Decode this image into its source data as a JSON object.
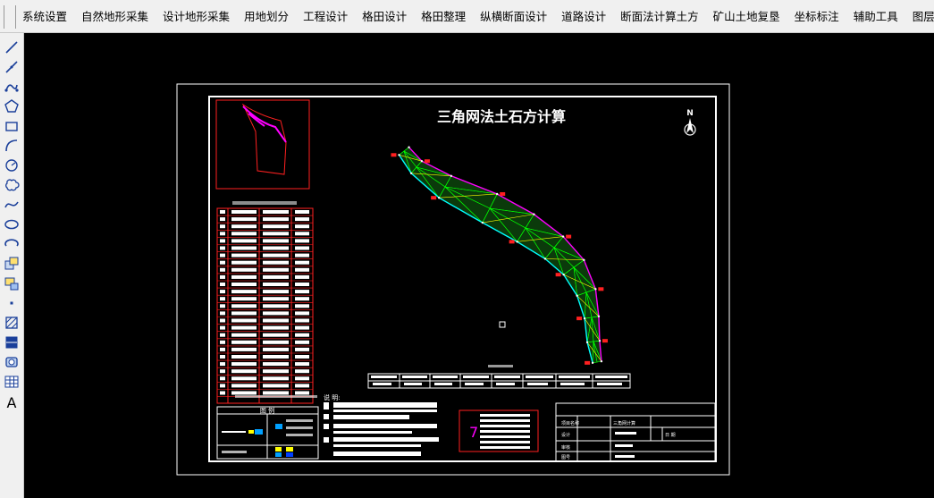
{
  "menu": {
    "items": [
      "系统设置",
      "自然地形采集",
      "设计地形采集",
      "用地划分",
      "工程设计",
      "格田设计",
      "格田整理",
      "纵横断面设计",
      "道路设计",
      "断面法计算土方",
      "矿山土地复垦",
      "坐标标注",
      "辅助工具",
      "图层图件"
    ]
  },
  "toolbar": {
    "tools": [
      "line-tool-icon",
      "polyline-tool-icon",
      "spline-connect-icon",
      "polygon-tool-icon",
      "rectangle-tool-icon",
      "arc-tool-icon",
      "circle-tool-icon",
      "cloud-tool-icon",
      "curve-tool-icon",
      "ellipse-tool-icon",
      "ellipse-arc-icon",
      "insert-block-icon",
      "make-block-icon",
      "point-tool-icon",
      "hatch-tool-icon",
      "gradient-tool-icon",
      "region-tool-icon",
      "table-tool-icon",
      "text-tool-icon"
    ],
    "text_tool_label": "A"
  },
  "drawing": {
    "title": "三角网法土石方计算",
    "north_label": "N",
    "legend_title": "图 例",
    "notes_label": "说 明:",
    "volume_number": "7",
    "title_block": {
      "rows": [
        "项目名称",
        "设计",
        "审核",
        "图号"
      ],
      "fields": [
        "日 期"
      ],
      "values": [
        "三角网计算"
      ]
    },
    "colors": {
      "frame": "#ffffff",
      "red": "#ff2020",
      "magenta": "#ff00ff",
      "green": "#00ff00",
      "cyan": "#00ffff",
      "mesh": "#ffff00"
    }
  }
}
